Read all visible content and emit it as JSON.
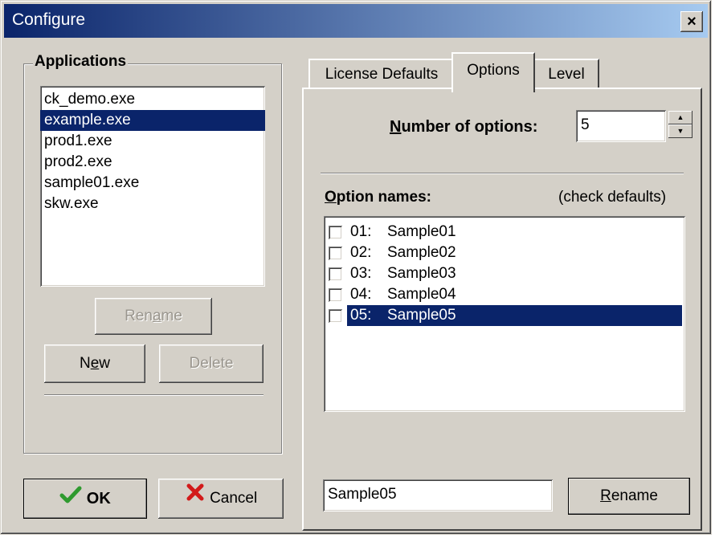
{
  "window": {
    "title": "Configure",
    "close_glyph": "×"
  },
  "applications": {
    "group_title": "Applications",
    "items": [
      "ck_demo.exe",
      "example.exe",
      "prod1.exe",
      "prod2.exe",
      "sample01.exe",
      "skw.exe"
    ],
    "selected_index": 1,
    "rename_label_a": "Ren",
    "rename_label_u": "a",
    "rename_label_b": "me",
    "new_label_a": "N",
    "new_label_u": "e",
    "new_label_b": "w",
    "delete_label": "Delete"
  },
  "buttons": {
    "ok_label": "OK",
    "cancel_label": "Cancel",
    "ok_icon": "checkmark-icon",
    "cancel_icon": "red-x-icon"
  },
  "tabs": [
    {
      "label": "License Defaults",
      "active": false
    },
    {
      "label": "Options",
      "active": true
    },
    {
      "label": "Level",
      "active": false
    }
  ],
  "options": {
    "number_label_u": "N",
    "number_label_rest": "umber of options:",
    "number_value": "5",
    "names_label_u": "O",
    "names_label_rest": "ption names:",
    "check_defaults": "(check defaults)",
    "items": [
      {
        "num": "01:",
        "name": "Sample01",
        "checked": false,
        "selected": false
      },
      {
        "num": "02:",
        "name": "Sample02",
        "checked": false,
        "selected": false
      },
      {
        "num": "03:",
        "name": "Sample03",
        "checked": false,
        "selected": false
      },
      {
        "num": "04:",
        "name": "Sample04",
        "checked": false,
        "selected": false
      },
      {
        "num": "05:",
        "name": "Sample05",
        "checked": false,
        "selected": true
      }
    ],
    "rename_input_value": "Sample05",
    "rename_button_u": "R",
    "rename_button_rest": "ename"
  },
  "colors": {
    "face": "#d4d0c8",
    "selection": "#0a246a",
    "title_gradient_start": "#0a246a",
    "title_gradient_end": "#a6caf0",
    "ok_check": "#2f9a2f",
    "cancel_x": "#d21a1a"
  }
}
